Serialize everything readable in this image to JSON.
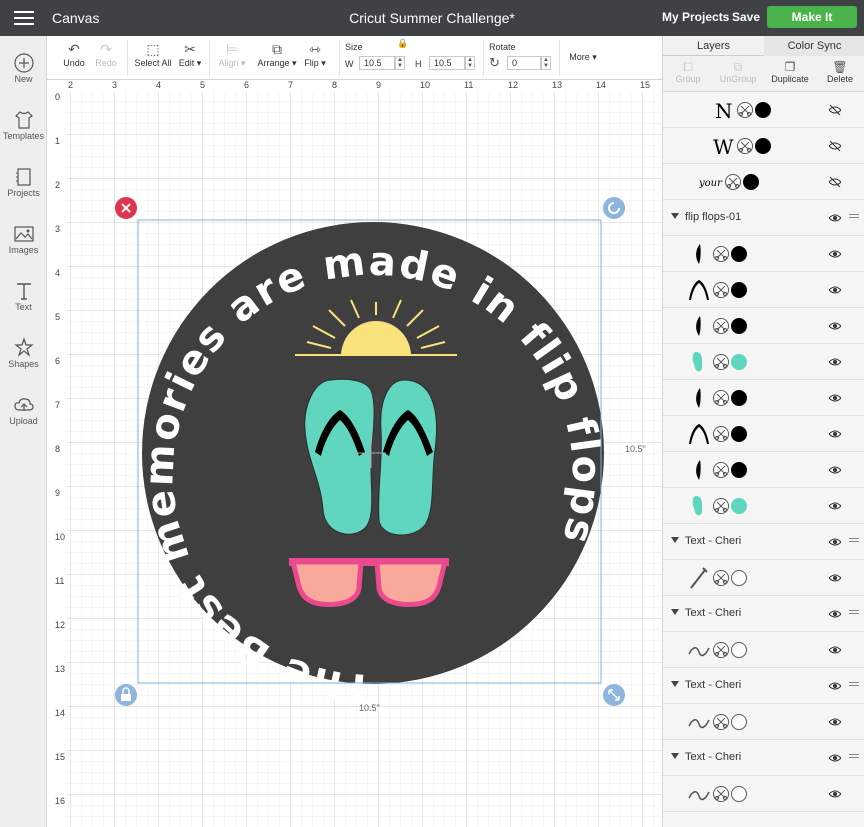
{
  "topbar": {
    "app_title": "Canvas",
    "document_title": "Cricut Summer Challenge*",
    "my_projects": "My Projects",
    "save": "Save",
    "make_it": "Make It"
  },
  "leftbar": {
    "items": [
      {
        "label": "New",
        "icon": "plus-circle-icon"
      },
      {
        "label": "Templates",
        "icon": "tshirt-icon"
      },
      {
        "label": "Projects",
        "icon": "projects-icon"
      },
      {
        "label": "Images",
        "icon": "image-icon"
      },
      {
        "label": "Text",
        "icon": "text-icon"
      },
      {
        "label": "Shapes",
        "icon": "shapes-icon"
      },
      {
        "label": "Upload",
        "icon": "upload-cloud-icon"
      }
    ]
  },
  "toolbar": {
    "undo": "Undo",
    "redo": "Redo",
    "select_all": "Select All",
    "edit": "Edit",
    "align": "Align",
    "arrange": "Arrange",
    "flip": "Flip",
    "size_label": "Size",
    "w_label": "W",
    "w_value": "10.5",
    "h_label": "H",
    "h_value": "10.5",
    "rotate_label": "Rotate",
    "rotate_value": "0",
    "more": "More"
  },
  "canvas": {
    "ruler_top": [
      "2",
      "3",
      "4",
      "5",
      "6",
      "7",
      "8",
      "9",
      "10",
      "11",
      "12",
      "13",
      "14",
      "15"
    ],
    "ruler_left": [
      "0",
      "1",
      "2",
      "3",
      "4",
      "5",
      "6",
      "7",
      "8",
      "9",
      "10",
      "11",
      "12",
      "13",
      "14",
      "15",
      "16"
    ],
    "width_label": "10.5\"",
    "height_label": "10.5\"",
    "design_text": "The Best memories are made in flip flops",
    "colors": {
      "circle": "#3f3f3f",
      "flipflop": "#5fd6bd",
      "sun": "#f7e27c",
      "lens": "#f8a99c",
      "frame": "#ec4a8f",
      "selection": "#7fb1d9",
      "delete_handle": "#e0344f",
      "handle": "#8fb5de"
    }
  },
  "panel": {
    "tabs": [
      "Layers",
      "Color Sync"
    ],
    "actions": [
      {
        "label": "Group",
        "icon": "group-icon",
        "enabled": false
      },
      {
        "label": "UnGroup",
        "icon": "ungroup-icon",
        "enabled": false
      },
      {
        "label": "Duplicate",
        "icon": "duplicate-icon",
        "enabled": true
      },
      {
        "label": "Delete",
        "icon": "trash-icon",
        "enabled": true
      }
    ],
    "layers": [
      {
        "type": "layer",
        "thumb": "N",
        "color": "#000000",
        "hidden": true
      },
      {
        "type": "layer",
        "thumb": "W",
        "color": "#000000",
        "hidden": true
      },
      {
        "type": "layer",
        "thumb": "your",
        "color": "#000000",
        "hidden": true
      },
      {
        "type": "group",
        "name": "flip flops-01"
      },
      {
        "type": "layer",
        "thumb": "leaf",
        "color": "#000000"
      },
      {
        "type": "layer",
        "thumb": "strap",
        "color": "#000000"
      },
      {
        "type": "layer",
        "thumb": "leaf",
        "color": "#000000"
      },
      {
        "type": "layer",
        "thumb": "sole",
        "color": "#5fd6bd"
      },
      {
        "type": "layer",
        "thumb": "leaf",
        "color": "#000000"
      },
      {
        "type": "layer",
        "thumb": "strap",
        "color": "#000000"
      },
      {
        "type": "layer",
        "thumb": "leaf",
        "color": "#000000"
      },
      {
        "type": "layer",
        "thumb": "sole",
        "color": "#5fd6bd"
      },
      {
        "type": "group",
        "name": "Text - Cheri"
      },
      {
        "type": "layer",
        "thumb": "brush",
        "color": "#ffffff"
      },
      {
        "type": "group",
        "name": "Text - Cheri"
      },
      {
        "type": "layer",
        "thumb": "script",
        "color": "#ffffff"
      },
      {
        "type": "group",
        "name": "Text - Cheri"
      },
      {
        "type": "layer",
        "thumb": "script",
        "color": "#ffffff"
      },
      {
        "type": "group",
        "name": "Text - Cheri"
      },
      {
        "type": "layer",
        "thumb": "script",
        "color": "#ffffff"
      }
    ]
  }
}
